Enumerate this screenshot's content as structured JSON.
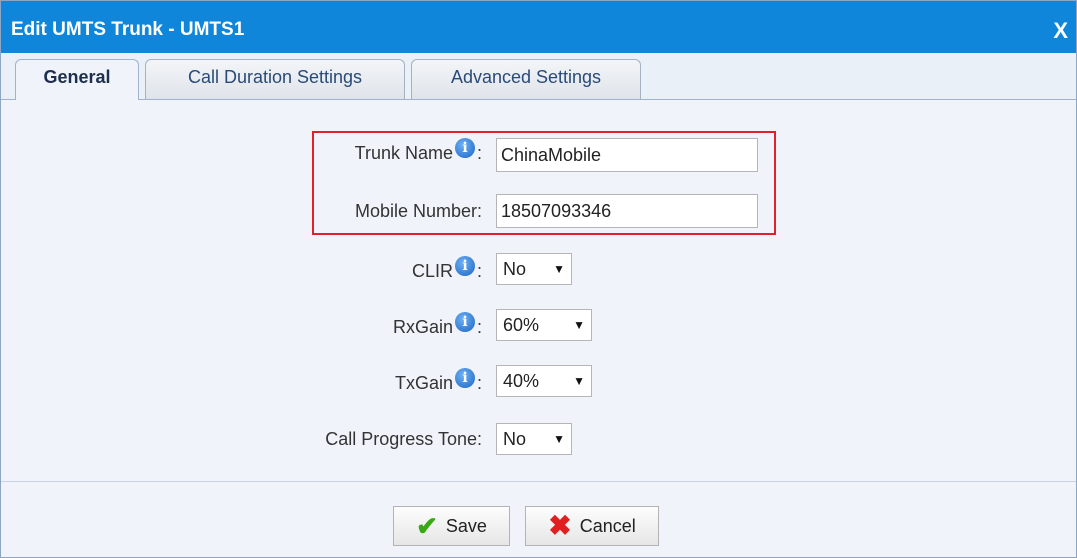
{
  "dialog": {
    "title": "Edit UMTS Trunk - UMTS1",
    "close_label": "X"
  },
  "tabs": [
    {
      "label": "General",
      "active": true
    },
    {
      "label": "Call Duration Settings",
      "active": false
    },
    {
      "label": "Advanced Settings",
      "active": false
    }
  ],
  "form": {
    "trunk_name": {
      "label": "Trunk Name",
      "value": "ChinaMobile"
    },
    "mobile_number": {
      "label": "Mobile Number:",
      "value": "18507093346"
    },
    "clir": {
      "label": "CLIR",
      "value": "No"
    },
    "rxgain": {
      "label": "RxGain",
      "value": "60%"
    },
    "txgain": {
      "label": "TxGain",
      "value": "40%"
    },
    "call_progress_tone": {
      "label": "Call Progress Tone:",
      "value": "No"
    },
    "colon": ":"
  },
  "buttons": {
    "save_label": "Save",
    "cancel_label": "Cancel"
  },
  "icons": {
    "info": "info-icon",
    "dropdown": "chevron-down-icon",
    "save": "check-icon",
    "cancel": "x-icon"
  },
  "colors": {
    "titlebar": "#0f86d9",
    "highlight": "#e0202a",
    "info_icon": "#1a64c8"
  }
}
